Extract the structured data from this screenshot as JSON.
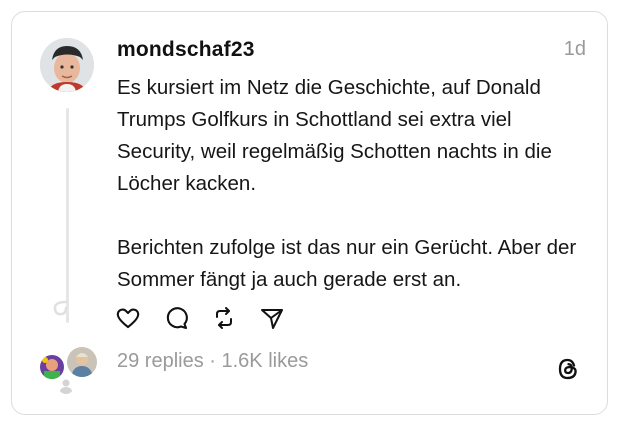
{
  "post": {
    "username": "mondschaf23",
    "time": "1d",
    "paragraphs": [
      "Es kursiert im Netz die Geschichte, auf Donald Trumps Golfkurs in Schottland sei extra viel Security, weil regelmäßig Schotten nachts in die Löcher kacken.",
      "Berichten zufolge ist das nur ein Gerücht. Aber der Sommer fängt ja auch gerade erst an."
    ]
  },
  "actions": {
    "icons": [
      "heart-icon",
      "comment-icon",
      "repost-icon",
      "share-icon"
    ]
  },
  "stats": {
    "replies": "29 replies",
    "separator": " · ",
    "likes": "1.6K likes"
  },
  "colors": {
    "text": "#161616",
    "muted": "#9a9a9a",
    "border": "#dcdcdc"
  }
}
